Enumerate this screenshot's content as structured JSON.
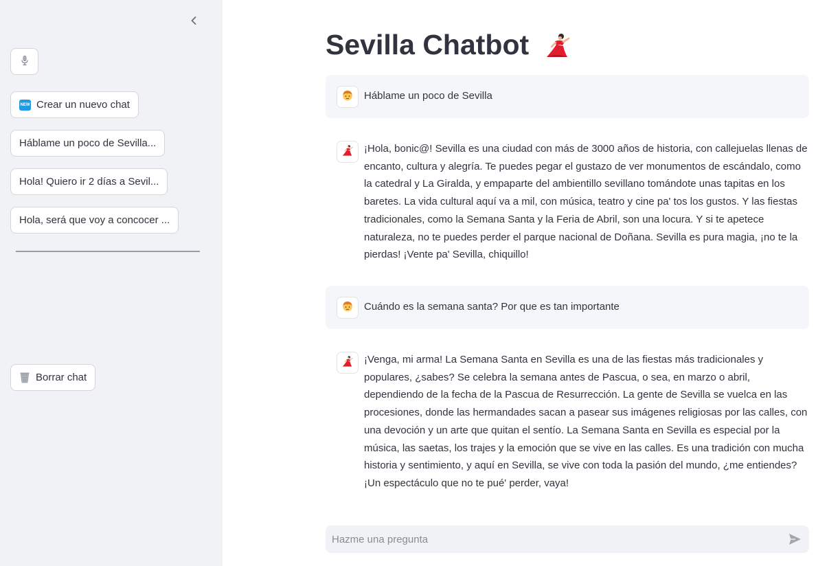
{
  "sidebar": {
    "collapse_icon": "chevron-left-icon",
    "mic_icon": "microphone-icon",
    "new_chat": {
      "badge": "NEW",
      "label": "Crear un nuevo chat"
    },
    "history": [
      "Háblame un poco de Sevilla...",
      "Hola! Quiero ir 2 días a Sevil...",
      "Hola, será que voy a concocer ..."
    ],
    "clear_chat": {
      "icon": "wastebasket-icon",
      "label": "Borrar chat"
    }
  },
  "main": {
    "title": "Sevilla Chatbot",
    "title_icon": "dancer-emoji",
    "messages": [
      {
        "role": "user",
        "avatar": "person-emoji",
        "text": "Háblame un poco de Sevilla"
      },
      {
        "role": "assistant",
        "avatar": "dancer-emoji",
        "text": "¡Hola, bonic@! Sevilla es una ciudad con más de 3000 años de historia, con callejuelas llenas de encanto, cultura y alegría. Te puedes pegar el gustazo de ver monumentos de escándalo, como la catedral y La Giralda, y empaparte del ambientillo sevillano tomándote unas tapitas en los baretes. La vida cultural aquí va a mil, con música, teatro y cine pa' tos los gustos. Y las fiestas tradicionales, como la Semana Santa y la Feria de Abril, son una locura. Y si te apetece naturaleza, no te puedes perder el parque nacional de Doñana. Sevilla es pura magia, ¡no te la pierdas! ¡Vente pa' Sevilla, chiquillo!"
      },
      {
        "role": "user",
        "avatar": "person-emoji",
        "text": "Cuándo es la semana santa? Por que es tan importante"
      },
      {
        "role": "assistant",
        "avatar": "dancer-emoji",
        "text": "¡Venga, mi arma! La Semana Santa en Sevilla es una de las fiestas más tradicionales y populares, ¿sabes? Se celebra la semana antes de Pascua, o sea, en marzo o abril, dependiendo de la fecha de la Pascua de Resurrección. La gente de Sevilla se vuelca en las procesiones, donde las hermandades sacan a pasear sus imágenes religiosas por las calles, con una devoción y un arte que quitan el sentío. La Semana Santa en Sevilla es especial por la música, las saetas, los trajes y la emoción que se vive en las calles. Es una tradición con mucha historia y sentimiento, y aquí en Sevilla, se vive con toda la pasión del mundo, ¿me entiendes? ¡Un espectáculo que no te pué' perder, vaya!"
      }
    ],
    "input": {
      "placeholder": "Hazme una pregunta",
      "value": "",
      "send_icon": "send-icon"
    }
  },
  "colors": {
    "sidebar_bg": "#f0f2f6",
    "user_msg_bg": "#f5f6f9",
    "text": "#31333f",
    "new_badge": "#1f9be6"
  }
}
